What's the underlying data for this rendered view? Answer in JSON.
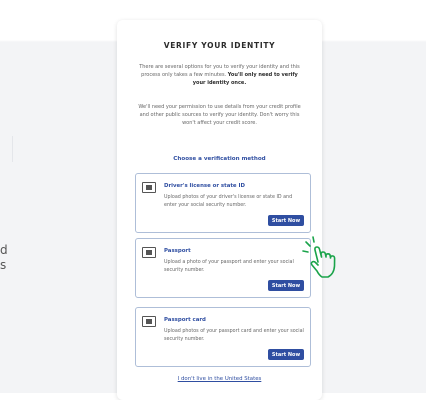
{
  "background": {
    "left_fragment_1": "d",
    "left_fragment_2": "s"
  },
  "card": {
    "title": "VERIFY YOUR IDENTITY",
    "intro_text": "There are several options for you to verify your identity and this process only takes a few minutes.",
    "intro_bold": "You'll only need to verify your identity once.",
    "permission_text": "We'll need your permission to use details from your credit profile and other public sources to verify your identity. Don't worry this won't affect your credit score.",
    "choose_label": "Choose a verification method",
    "options": [
      {
        "title": "Driver's license or state ID",
        "description": "Upload photos of your driver's license or state ID and enter your social security number.",
        "button_label": "Start Now",
        "icon": "id-card-icon"
      },
      {
        "title": "Passport",
        "description": "Upload a photo of your passport and enter your social security number.",
        "button_label": "Start Now",
        "icon": "passport-icon"
      },
      {
        "title": "Passport card",
        "description": "Upload photos of your passport card and enter your social security number.",
        "button_label": "Start Now",
        "icon": "passport-card-icon"
      }
    ],
    "footer_link": "I don't live in the United States"
  },
  "colors": {
    "accent": "#2f4ea1",
    "option_border": "#aebed8",
    "hand_cursor": "#1aa34a",
    "page_background": "#f3f4f6"
  }
}
